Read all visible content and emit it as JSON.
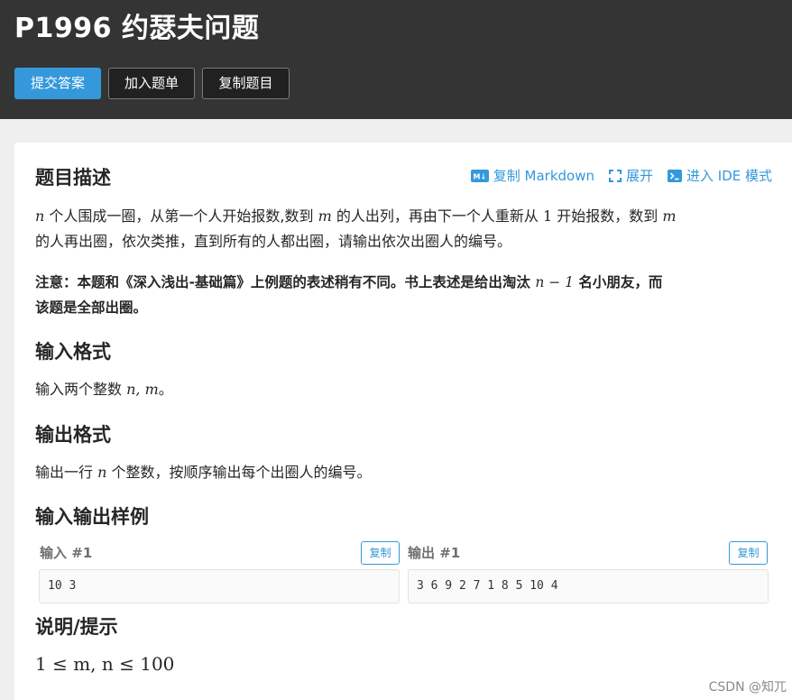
{
  "header": {
    "title": "P1996 约瑟夫问题",
    "buttons": {
      "submit": "提交答案",
      "add_to_list": "加入题单",
      "copy_problem": "复制题目"
    }
  },
  "colors": {
    "accent": "#3498db",
    "header_bg": "#343434",
    "button_dark": "#212121"
  },
  "toolbar": {
    "copy_markdown": {
      "icon": "markdown-icon",
      "label": "复制 Markdown"
    },
    "expand": {
      "icon": "expand-icon",
      "label": "展开"
    },
    "ide_mode": {
      "icon": "terminal-icon",
      "label": "进入 IDE 模式"
    }
  },
  "sections": {
    "description": {
      "heading": "题目描述",
      "p1": {
        "var_n": "n",
        "t1": " 个人围成一圈，从第一个人开始报数,数到 ",
        "var_m": "m",
        "t2": " 的人出列，再由下一个人重新从 ",
        "num_1": "1",
        "t3": " 开始报数，数到 ",
        "var_m2": "m",
        "t4": "的人再出圈，依次类推，直到所有的人都出圈，请输出依次出圈人的编号。"
      },
      "note": {
        "t1": "注意：本题和《深入浅出-基础篇》上例题的表述稍有不同。书上表述是给出淘汰 ",
        "expr": "n − 1",
        "t2": " 名小朋友，而",
        "t3": "该题是全部出圈。"
      }
    },
    "input_format": {
      "heading": "输入格式",
      "t1": "输入两个整数 ",
      "expr": "n, m",
      "t2": "。"
    },
    "output_format": {
      "heading": "输出格式",
      "t1": "输出一行 ",
      "var_n": "n",
      "t2": " 个整数，按顺序输出每个出圈人的编号。"
    },
    "samples": {
      "heading": "输入输出样例",
      "input_label": "输入 #1",
      "output_label": "输出 #1",
      "copy_label": "复制",
      "input_value": "10 3",
      "output_value": "3 6 9 2 7 1 8 5 10 4"
    },
    "hint": {
      "heading": "说明/提示",
      "expr": "1 ≤ m, n ≤ 100"
    }
  },
  "watermark": "CSDN @知兀"
}
